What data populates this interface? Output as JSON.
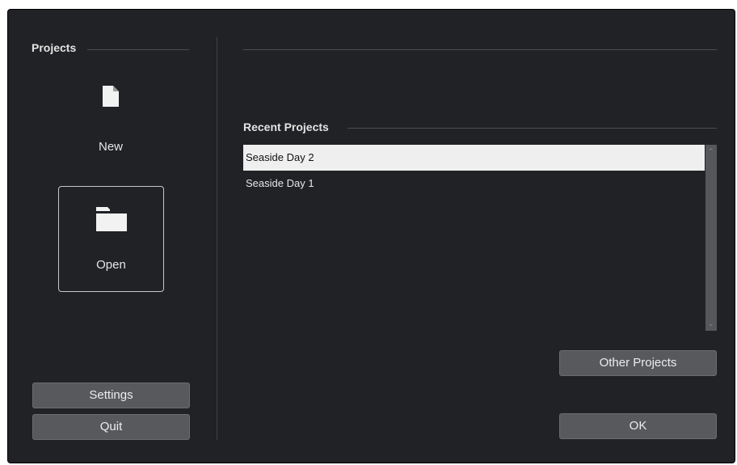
{
  "projects": {
    "title": "Projects",
    "new_label": "New",
    "new_icon": "document-icon",
    "open_label": "Open",
    "open_icon": "folder-icon",
    "settings_label": "Settings",
    "quit_label": "Quit"
  },
  "recent": {
    "title": "Recent Projects",
    "items": [
      {
        "label": "Seaside Day 2",
        "selected": true
      },
      {
        "label": "Seaside Day 1",
        "selected": false
      }
    ],
    "other_projects_label": "Other Projects",
    "ok_label": "OK"
  },
  "colors": {
    "background": "#202225",
    "button": "#57595d",
    "selected_row": "#efefef",
    "text": "#e6e6e6"
  }
}
